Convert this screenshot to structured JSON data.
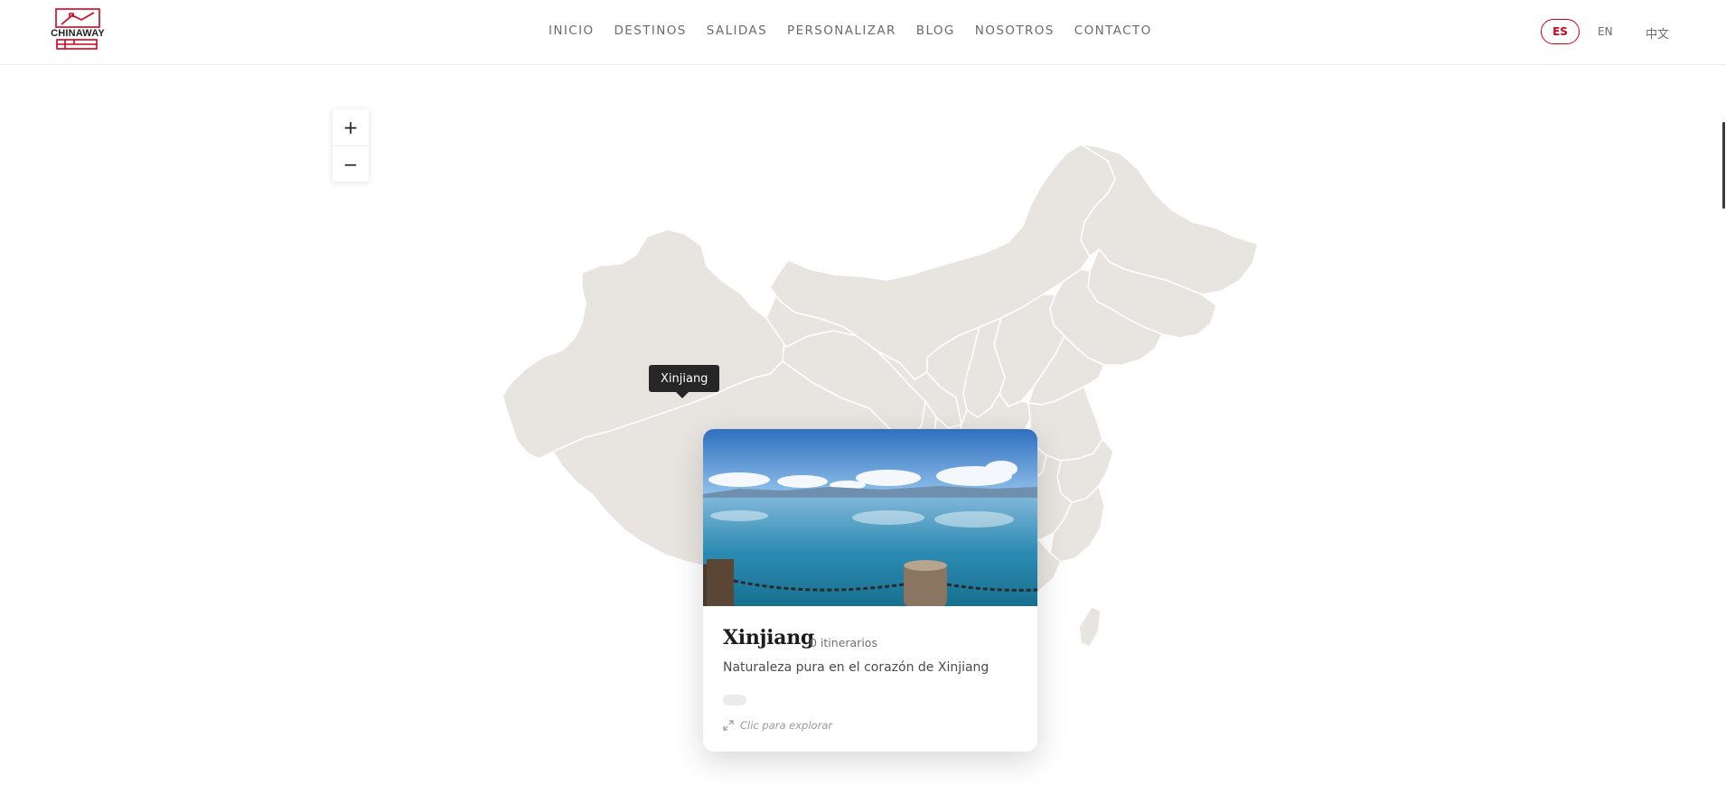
{
  "brand": {
    "name": "CHINAWAY",
    "color": "#d0021b"
  },
  "nav": {
    "items": [
      "INICIO",
      "DESTINOS",
      "SALIDAS",
      "PERSONALIZAR",
      "BLOG",
      "NOSOTROS",
      "CONTACTO"
    ]
  },
  "languages": {
    "active": "ES",
    "en": "EN",
    "zh": "中文"
  },
  "map": {
    "zoom_in": "+",
    "zoom_out": "−",
    "tooltip": "Xinjiang",
    "region_fill": "#e8e4df",
    "region_stroke": "#ffffff"
  },
  "card": {
    "title": "Xinjiang",
    "count": "0 itinerarios",
    "description": "Naturaleza pura en el corazón de Xinjiang",
    "cta": "Clic para explorar"
  }
}
